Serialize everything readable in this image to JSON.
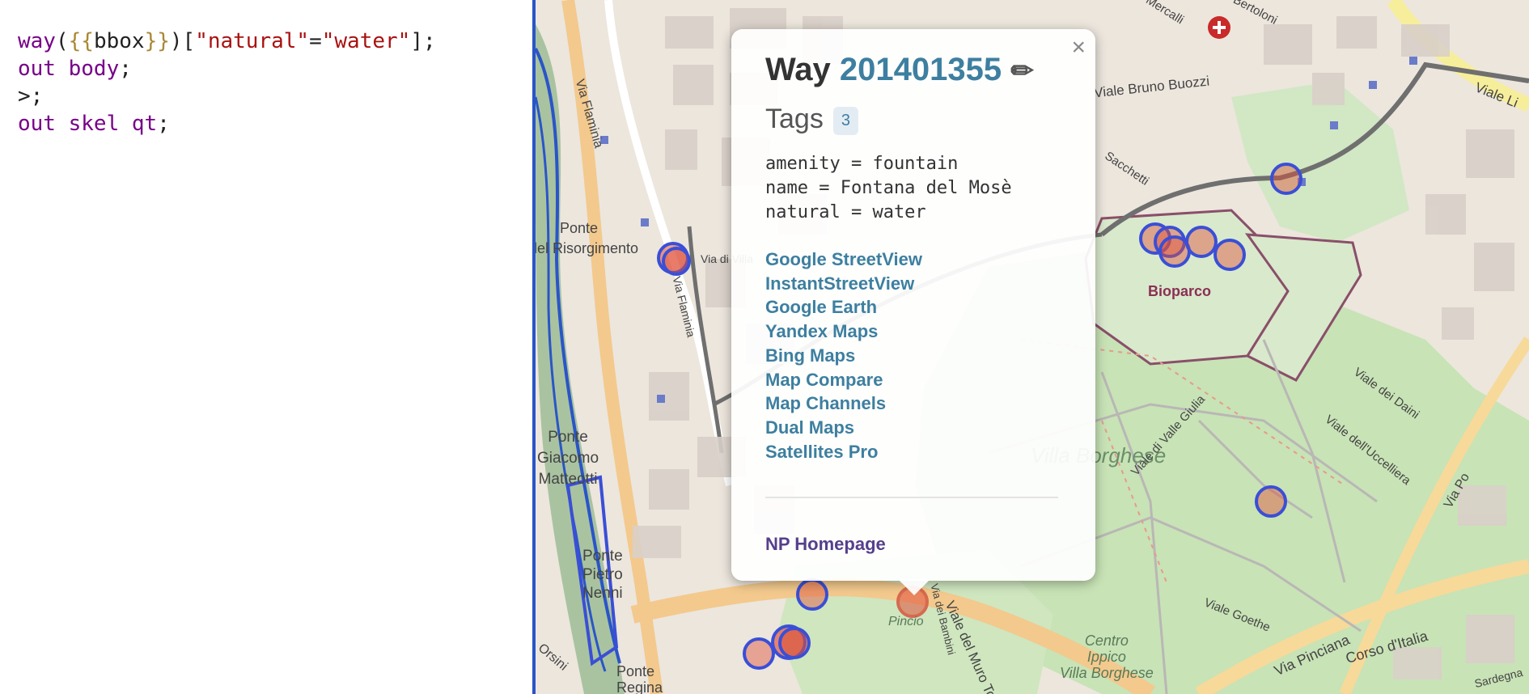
{
  "editor": {
    "lines": [
      [
        {
          "t": "way",
          "c": "kw"
        },
        {
          "t": "(",
          "c": "pl"
        },
        {
          "t": "{{",
          "c": "br"
        },
        {
          "t": "bbox",
          "c": "pl"
        },
        {
          "t": "}}",
          "c": "br"
        },
        {
          "t": ")[",
          "c": "pl"
        },
        {
          "t": "\"natural\"",
          "c": "str"
        },
        {
          "t": "=",
          "c": "pl"
        },
        {
          "t": "\"water\"",
          "c": "str"
        },
        {
          "t": "];",
          "c": "pl"
        }
      ],
      [
        {
          "t": "out body",
          "c": "kw"
        },
        {
          "t": ";",
          "c": "pl"
        }
      ],
      [
        {
          "t": ">;",
          "c": "pl"
        }
      ],
      [
        {
          "t": "out skel qt",
          "c": "kw"
        },
        {
          "t": ";",
          "c": "pl"
        }
      ]
    ]
  },
  "map": {
    "labels": {
      "bioparco": "Bioparco",
      "villa_borghese": "Villa Borghese",
      "centro_ippico": "Centro\nIppico\nVilla Borghese",
      "pincio": "Pincio",
      "ponte_risorgimento_1": "Ponte",
      "ponte_risorgimento_2": "del Risorgimento",
      "ponte_matteotti": "Ponte\nGiacomo\nMatteotti",
      "ponte_nenni": "Ponte\nPietro\nNenni",
      "ponte_regina": "Ponte\nRegina",
      "via_flaminia": "Via Flaminia",
      "via_flaminia_2": "Via Flaminia",
      "viale_bruno_buozzi": "Viale Bruno Buozzi",
      "viale_goethe": "Viale Goethe",
      "via_pinciana": "Via Pinciana",
      "corso_italia": "Corso d'Italia",
      "viale_uccelliera": "Viale dell'Uccelliera",
      "viale_daini": "Viale dei Daini",
      "viale_valle_giulia": "Viale di Valle Giulia",
      "muro_torto": "Viale del Muro Torto",
      "via_po": "Via Po",
      "viale_liegi": "Viale Li",
      "mercalli": "Mercalli",
      "bertoloni": "Bertoloni",
      "sacchetti": "Sacchetti",
      "sardegna": "Sardegna",
      "orsini": "Orsini",
      "bambini": "Via dei Bambini",
      "via_di_villa": "Via di Villa"
    },
    "colors": {
      "accent": "#3a4fd6",
      "highlight": "#e04f3a"
    }
  },
  "popup": {
    "close": "×",
    "title_prefix": "Way",
    "way_id": "201401355",
    "edit_icon": "✏",
    "tags_label": "Tags",
    "tags_count": "3",
    "tags": [
      "amenity = fountain",
      "name = Fontana del Mosè",
      "natural = water"
    ],
    "links": [
      "Google StreetView",
      "InstantStreetView",
      "Google Earth",
      "Yandex Maps",
      "Bing Maps",
      "Map Compare",
      "Map Channels",
      "Dual Maps",
      "Satellites Pro"
    ],
    "np_homepage": "NP Homepage"
  }
}
